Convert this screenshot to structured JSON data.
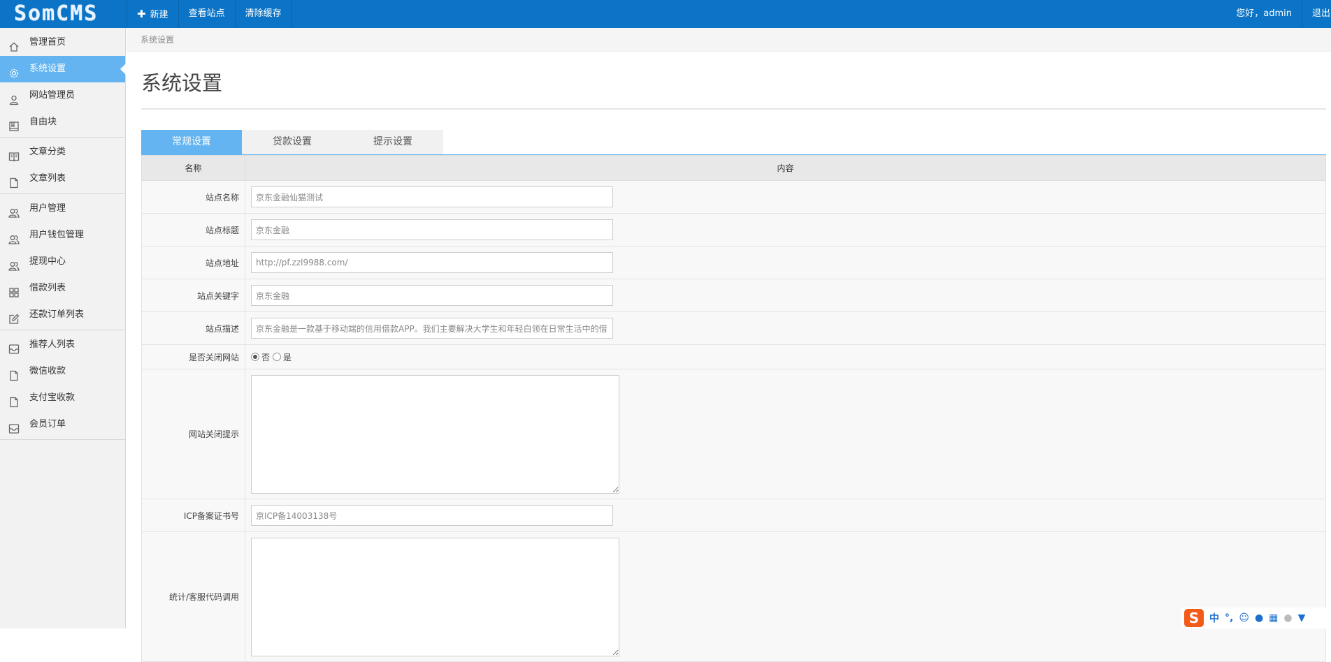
{
  "header": {
    "logo_text": "SomCMS",
    "nav": [
      {
        "label": "新建",
        "icon": "plus-icon"
      },
      {
        "label": "查看站点"
      },
      {
        "label": "清除缓存"
      }
    ],
    "greeting": "您好，admin",
    "logout_label": "退出"
  },
  "sidebar": {
    "groups": [
      [
        {
          "label": "管理首页",
          "icon": "home-icon"
        },
        {
          "label": "系统设置",
          "icon": "gear-icon",
          "active": true
        },
        {
          "label": "网站管理员",
          "icon": "user-icon"
        },
        {
          "label": "自由块",
          "icon": "block-icon"
        }
      ],
      [
        {
          "label": "文章分类",
          "icon": "book-icon"
        },
        {
          "label": "文章列表",
          "icon": "file-icon"
        }
      ],
      [
        {
          "label": "用户管理",
          "icon": "users-icon"
        },
        {
          "label": "用户钱包管理",
          "icon": "users-icon"
        },
        {
          "label": "提现中心",
          "icon": "users-icon"
        },
        {
          "label": "借款列表",
          "icon": "grid-icon"
        },
        {
          "label": "还款订单列表",
          "icon": "edit-icon"
        }
      ],
      [
        {
          "label": "推荐人列表",
          "icon": "inbox-icon"
        },
        {
          "label": "微信收款",
          "icon": "file-icon"
        },
        {
          "label": "支付宝收款",
          "icon": "file-icon"
        },
        {
          "label": "会员订单",
          "icon": "inbox-icon"
        }
      ]
    ]
  },
  "main": {
    "breadcrumb": "系统设置",
    "title": "系统设置",
    "tabs": [
      {
        "label": "常规设置",
        "active": true
      },
      {
        "label": "贷款设置"
      },
      {
        "label": "提示设置"
      }
    ],
    "table_headers": [
      "名称",
      "内容"
    ],
    "fields": {
      "site_name": {
        "label": "站点名称",
        "value": "京东金融仙猫测试"
      },
      "site_title": {
        "label": "站点标题",
        "value": "京东金融"
      },
      "site_url": {
        "label": "站点地址",
        "value": "http://pf.zzl9988.com/"
      },
      "site_keywords": {
        "label": "站点关键字",
        "value": "京东金融"
      },
      "site_desc": {
        "label": "站点描述",
        "value": "京东金融是一款基于移动端的信用借款APP。我们主要解决大学生和年轻白领在日常生活中的借"
      },
      "close_site": {
        "label": "是否关闭网站",
        "options": [
          "否",
          "是"
        ],
        "selected": "否"
      },
      "close_tip": {
        "label": "网站关闭提示",
        "value": ""
      },
      "icp": {
        "label": "ICP备案证书号",
        "value": "京ICP备14003138号"
      },
      "stats_code": {
        "label": "统计/客服代码调用",
        "value": ""
      }
    }
  },
  "ime": {
    "logo": "S",
    "mode": "中",
    "punct": "°,"
  }
}
